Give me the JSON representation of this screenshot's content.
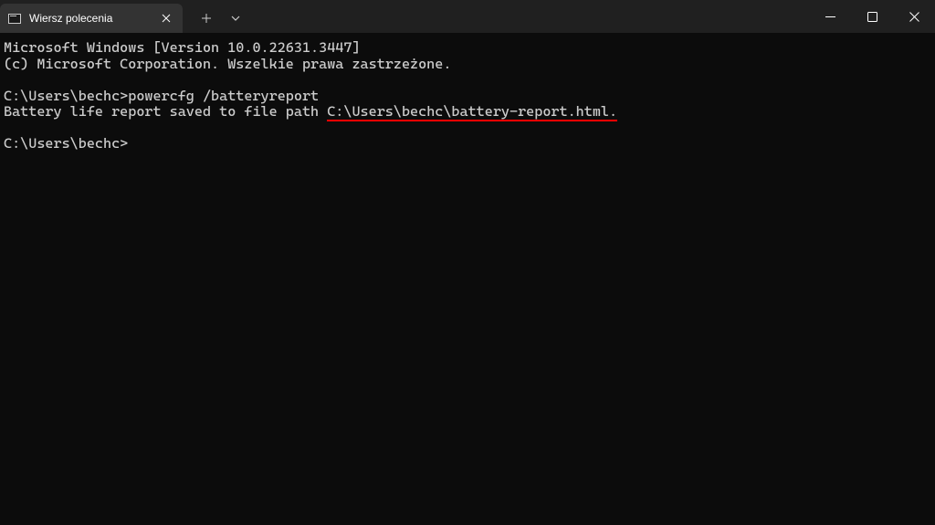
{
  "titlebar": {
    "tab": {
      "title": "Wiersz polecenia"
    }
  },
  "terminal": {
    "line1": "Microsoft Windows [Version 10.0.22631.3447]",
    "line2": "(c) Microsoft Corporation. Wszelkie prawa zastrzeżone.",
    "prompt1_prefix": "C:\\Users\\bechc>",
    "prompt1_command": "powercfg /batteryreport",
    "output_prefix": "Battery life report saved to file path ",
    "output_path": "C:\\Users\\bechc\\battery-report.html.",
    "prompt2_prefix": "C:\\Users\\bechc>"
  }
}
